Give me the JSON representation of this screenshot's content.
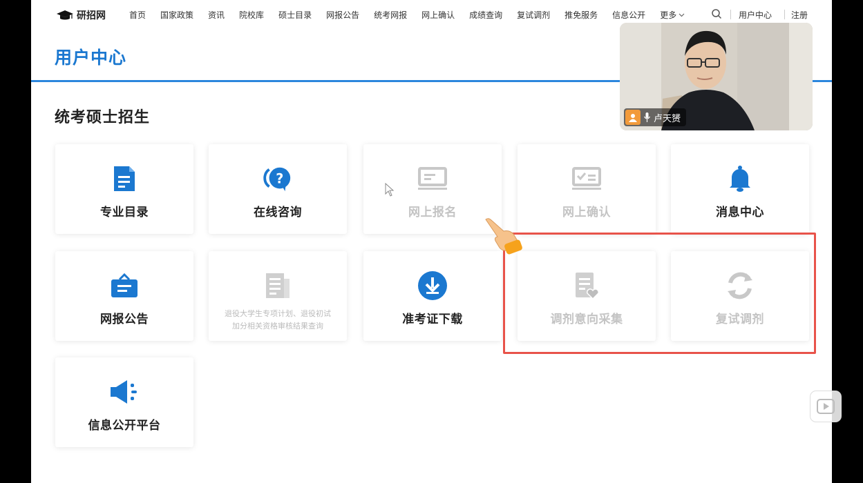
{
  "site": {
    "logo_text": "研招网"
  },
  "nav": {
    "items": [
      "首页",
      "国家政策",
      "资讯",
      "院校库",
      "硕士目录",
      "网报公告",
      "统考网报",
      "网上确认",
      "成绩查询",
      "复试调剂",
      "推免服务",
      "信息公开"
    ],
    "more": "更多",
    "user_center": "用户中心",
    "register": "注册"
  },
  "header": {
    "title": "用户中心"
  },
  "section": {
    "title": "统考硕士招生"
  },
  "cards": [
    {
      "label": "专业目录",
      "icon": "document-icon",
      "enabled": true
    },
    {
      "label": "在线咨询",
      "icon": "chat-question-icon",
      "enabled": true
    },
    {
      "label": "网上报名",
      "icon": "form-icon",
      "enabled": false
    },
    {
      "label": "网上确认",
      "icon": "checkbox-form-icon",
      "enabled": false
    },
    {
      "label": "消息中心",
      "icon": "bell-icon",
      "enabled": true
    },
    {
      "label": "网报公告",
      "icon": "briefcase-icon",
      "enabled": true
    },
    {
      "label": "退役大学生专项计划、退役初试加分相关资格审核结果查询",
      "line1": "退役大学生专项计划、退役初试",
      "line2": "加分相关资格审核结果查询",
      "icon": "newspaper-icon",
      "enabled": false
    },
    {
      "label": "准考证下载",
      "icon": "download-icon",
      "enabled": true
    },
    {
      "label": "调剂意向采集",
      "icon": "form-heart-icon",
      "enabled": false
    },
    {
      "label": "复试调剂",
      "icon": "refresh-icon",
      "enabled": false
    },
    {
      "label": "信息公开平台",
      "icon": "megaphone-icon",
      "enabled": true
    }
  ],
  "video": {
    "presenter_name": "卢天赟"
  },
  "colors": {
    "primary": "#1b78d0",
    "highlight": "#e8534a",
    "disabled": "#c4c4c4"
  }
}
